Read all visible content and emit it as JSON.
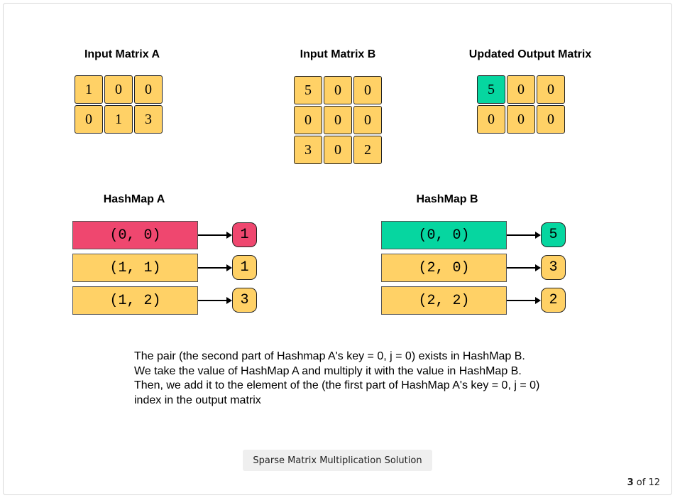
{
  "matrices": {
    "a": {
      "title": "Input Matrix A",
      "rows": [
        [
          "1",
          "0",
          "0"
        ],
        [
          "0",
          "1",
          "3"
        ]
      ]
    },
    "b": {
      "title": "Input Matrix B",
      "rows": [
        [
          "5",
          "0",
          "0"
        ],
        [
          "0",
          "0",
          "0"
        ],
        [
          "3",
          "0",
          "2"
        ]
      ]
    },
    "out": {
      "title": "Updated Output Matrix",
      "rows": [
        [
          "5",
          "0",
          "0"
        ],
        [
          "0",
          "0",
          "0"
        ]
      ],
      "highlight": "0,0"
    }
  },
  "hashmaps": {
    "a": {
      "title": "HashMap A",
      "entries": [
        {
          "key": "(0, 0)",
          "value": "1",
          "state": "red"
        },
        {
          "key": "(1, 1)",
          "value": "1",
          "state": "normal"
        },
        {
          "key": "(1, 2)",
          "value": "3",
          "state": "normal"
        }
      ]
    },
    "b": {
      "title": "HashMap B",
      "entries": [
        {
          "key": "(0, 0)",
          "value": "5",
          "state": "green"
        },
        {
          "key": "(2, 0)",
          "value": "3",
          "state": "normal"
        },
        {
          "key": "(2, 2)",
          "value": "2",
          "state": "normal"
        }
      ]
    }
  },
  "description": [
    "The pair (the second part of Hashmap A's key = 0, j = 0) exists in HashMap B.",
    "We take the value of HashMap A and multiply it with the value in HashMap B.",
    "Then, we add it to the element of the (the first part of HashMap A's key = 0, j = 0)",
    "index in the output matrix"
  ],
  "caption": "Sparse Matrix Multiplication Solution",
  "pager": {
    "current": "3",
    "of_label": "of",
    "total": "12"
  },
  "colors": {
    "cell": "#ffd166",
    "highlight_green": "#06d6a0",
    "highlight_red": "#ef476f"
  }
}
